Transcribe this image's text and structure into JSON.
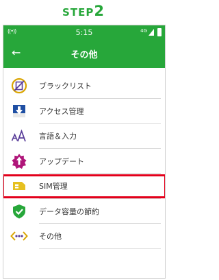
{
  "step": {
    "word": "STEP",
    "number": "2",
    "color": "#27a73a"
  },
  "status_bar": {
    "time": "5:15",
    "network": "4G"
  },
  "app_bar": {
    "title": "その他",
    "back_icon": "arrow-left-icon"
  },
  "menu": {
    "items": [
      {
        "label": "ブラックリスト",
        "icon": "blacklist-icon"
      },
      {
        "label": "アクセス管理",
        "icon": "access-control-icon"
      },
      {
        "label": "言語＆入力",
        "icon": "language-input-icon"
      },
      {
        "label": "アップデート",
        "icon": "update-icon"
      },
      {
        "label": "SIM管理",
        "icon": "sim-card-icon",
        "highlighted": true
      },
      {
        "label": "データ容量の節約",
        "icon": "data-saver-icon"
      },
      {
        "label": "その他",
        "icon": "more-icon"
      }
    ]
  },
  "colors": {
    "accent": "#27a73a",
    "highlight": "#e3001b",
    "icon_purple": "#5a3e9a",
    "icon_blue": "#1f4fa3",
    "icon_magenta": "#b0167a",
    "icon_gold": "#d9a400"
  }
}
